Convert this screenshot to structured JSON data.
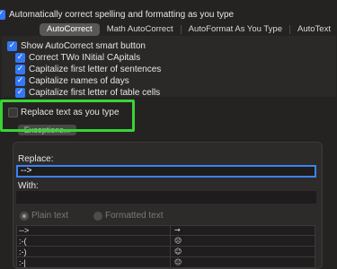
{
  "options": {
    "auto_correct": {
      "label": "Automatically correct spelling and formatting as you type",
      "checked": true
    }
  },
  "tabs": [
    {
      "label": "AutoCorrect",
      "active": true
    },
    {
      "label": "Math AutoCorrect",
      "active": false
    },
    {
      "label": "AutoFormat As You Type",
      "active": false
    },
    {
      "label": "AutoText",
      "active": false
    }
  ],
  "autocorrect": {
    "show_smart_button": {
      "label": "Show AutoCorrect smart button",
      "checked": true
    },
    "two_initial_capitals": {
      "label": "Correct TWo INitial CApitals",
      "checked": true
    },
    "capitalize_sentences": {
      "label": "Capitalize first letter of sentences",
      "checked": true
    },
    "capitalize_days": {
      "label": "Capitalize names of days",
      "checked": true
    },
    "capitalize_table_cells": {
      "label": "Capitalize first letter of table cells",
      "checked": true
    },
    "replace_text": {
      "label": "Replace text as you type",
      "checked": false
    },
    "exceptions_label": "Exceptions..."
  },
  "replace_panel": {
    "replace_label": "Replace:",
    "replace_value": "-->",
    "with_label": "With:",
    "with_value": "",
    "plain_text_label": "Plain text",
    "formatted_text_label": "Formatted text",
    "selected_format": "Plain text"
  },
  "table": {
    "rows": [
      {
        "replace": "-->",
        "with": "→"
      },
      {
        "replace": ":-(",
        "with": "☹"
      },
      {
        "replace": ":-)",
        "with": "☺"
      },
      {
        "replace": ":-|",
        "with": "😐"
      }
    ]
  },
  "colors": {
    "background": "#252322",
    "accent_blue": "#3478f6",
    "highlight_green": "#38d437"
  }
}
